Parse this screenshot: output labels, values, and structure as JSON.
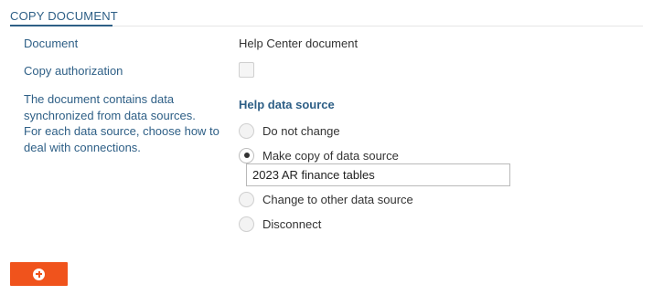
{
  "section": {
    "title": "COPY DOCUMENT"
  },
  "fields": {
    "document_label": "Document",
    "document_value": "Help Center document",
    "copy_authorization_label": "Copy authorization",
    "copy_authorization_checked": false
  },
  "description": {
    "lines": [
      "The document contains data",
      "synchronized from data sources.",
      "For each data source, choose how to",
      "deal with connections."
    ]
  },
  "data_source": {
    "title": "Help data source",
    "options": [
      {
        "label": "Do not change",
        "checked": false
      },
      {
        "label": "Make copy of data source",
        "checked": true
      },
      {
        "label": "Change to other data source",
        "checked": false
      },
      {
        "label": "Disconnect",
        "checked": false
      }
    ],
    "copy_name_value": "2023 AR finance tables"
  },
  "footer": {
    "add_icon": "plus-circle-icon",
    "accent_color": "#f0531c"
  },
  "colors": {
    "label_blue": "#2e5f86",
    "text": "#333333"
  }
}
